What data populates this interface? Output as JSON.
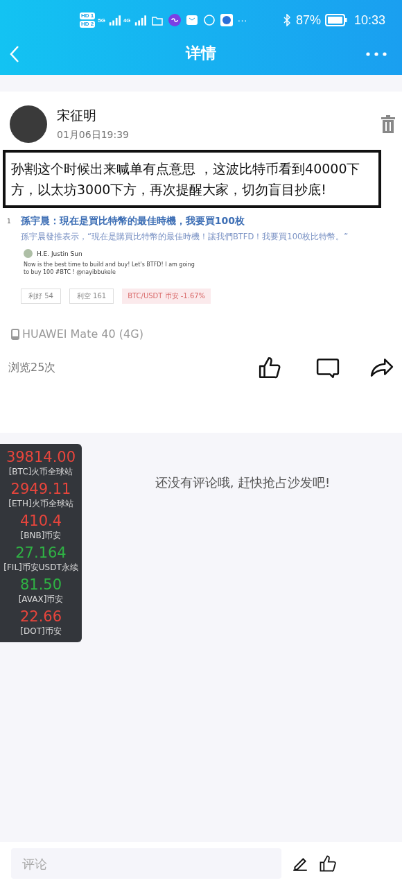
{
  "status_bar": {
    "sim_1": "HD 1",
    "sim_2": "HD 2",
    "network_1": "5G",
    "network_2": "4G",
    "more": "···",
    "battery": "87%",
    "time": "10:33"
  },
  "header": {
    "title": "详情"
  },
  "post": {
    "author": "宋征明",
    "time": "01月06日19:39",
    "text": "孙割这个时候出来喊单有点意思 ，这波比特币看到40000下方，以太坊3000下方，再次提醒大家，切勿盲目抄底!",
    "embed": {
      "marker": "1",
      "headline": "孫宇晨：現在是買比特幣的最佳時機，我要買100枚",
      "summary": "孫宇晨發推表示，“現在是購買比特幣的最佳時機！讓我們BTFD！我要買100枚比特幣。”",
      "tweet": {
        "author": "H.E. Justin Sun",
        "text": "Now is the best time to build and buy! Let's BTFD! I am going to buy 100 #BTC ! @nayibbukele"
      },
      "bull": "利好 54",
      "bear": "利空 161",
      "ticker": "BTC/USDT 币安 -1.67%"
    },
    "device": "HUAWEI Mate 40 (4G)",
    "views": "浏览25次"
  },
  "comments": {
    "empty": "还没有评论哦, 赶快抢占沙发吧!"
  },
  "prices": [
    {
      "price": "39814.00",
      "name": "[BTC]火币全球站",
      "color": "#e8453c"
    },
    {
      "price": "2949.11",
      "name": "[ETH]火币全球站",
      "color": "#e8453c"
    },
    {
      "price": "410.4",
      "name": "[BNB]币安",
      "color": "#e8453c"
    },
    {
      "price": "27.164",
      "name": "[FIL]币安USDT永续",
      "color": "#2fb344"
    },
    {
      "price": "81.50",
      "name": "[AVAX]币安",
      "color": "#2fb344"
    },
    {
      "price": "22.66",
      "name": "[DOT]币安",
      "color": "#e8453c"
    }
  ],
  "comment_bar": {
    "placeholder": "评论"
  }
}
